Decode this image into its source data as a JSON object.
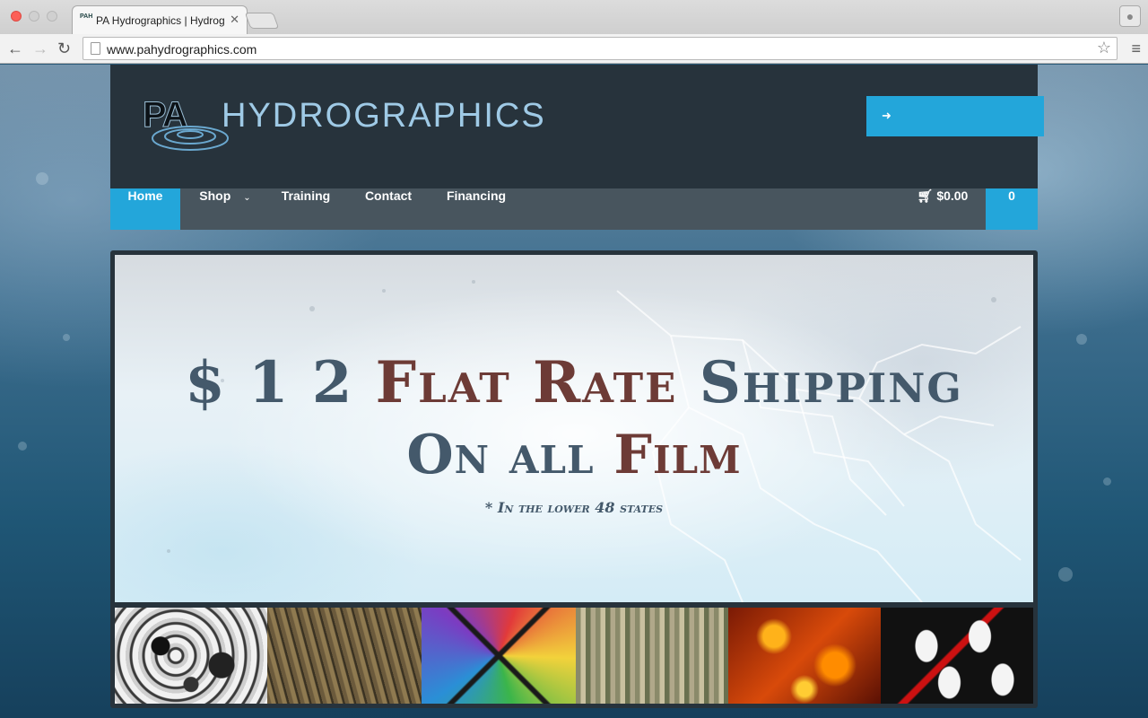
{
  "browser": {
    "tab_title": "PA Hydrographics | Hydrog",
    "tab_favicon_text": "PAH",
    "url": "www.pahydrographics.com"
  },
  "header": {
    "logo_pa": "PA",
    "logo_text": "HYDROGRAPHICS",
    "login_icon": "sign-in-icon",
    "login_label": ""
  },
  "nav": {
    "items": [
      {
        "label": "Home",
        "active": true
      },
      {
        "label": "Shop",
        "has_dropdown": true
      },
      {
        "label": "Training"
      },
      {
        "label": "Contact"
      },
      {
        "label": "Financing"
      }
    ],
    "cart_total": "$0.00",
    "cart_count": "0"
  },
  "hero": {
    "price": "$ 1 2",
    "line1_accent": "Flat Rate",
    "line1_end": "Shipping",
    "line2_start": "On all",
    "line2_accent": "Film",
    "note": "* In the lower 48 states"
  },
  "thumbnails": [
    {
      "pattern": "black-white-skulls"
    },
    {
      "pattern": "grass-camo"
    },
    {
      "pattern": "comic-book"
    },
    {
      "pattern": "digital-camo"
    },
    {
      "pattern": "flames"
    },
    {
      "pattern": "masks"
    }
  ],
  "colors": {
    "accent_blue": "#23a6da",
    "header_bg": "#27333c",
    "nav_bg": "#48555e",
    "hero_slate": "#44596b",
    "hero_brown": "#6d3b36"
  }
}
